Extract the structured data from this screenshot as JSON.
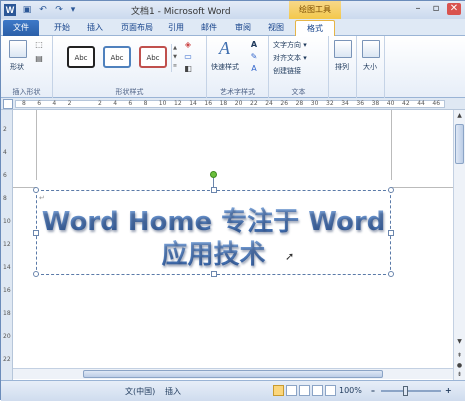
{
  "titlebar": {
    "app_icon": "W",
    "title": "文档1 - Microsoft Word",
    "tool_context": "绘图工具",
    "qat_icons": [
      "save-icon",
      "undo-icon",
      "redo-icon",
      "dropdown-icon"
    ],
    "qat_glyphs": [
      "▣",
      "↶",
      "↷",
      "▾"
    ],
    "win_glyphs": [
      "–",
      "▫",
      "✕"
    ]
  },
  "tabs": [
    "文件",
    "开始",
    "插入",
    "页面布局",
    "引用",
    "邮件",
    "审阅",
    "视图",
    "格式"
  ],
  "ribbon": {
    "groups": {
      "insert_shapes": {
        "label": "插入形状",
        "shapes_label": "形状"
      },
      "shape_styles": {
        "label": "形状样式",
        "swatches": [
          "Abc",
          "Abc",
          "Abc"
        ]
      },
      "wordart_styles": {
        "label": "艺术字样式",
        "quick_styles_label": "快速样式"
      },
      "text": {
        "label": "文本",
        "items": [
          "文字方向 ▾",
          "对齐文本 ▾",
          "创建链接"
        ]
      },
      "arrange": {
        "label": "排列"
      },
      "size": {
        "label": "大小"
      }
    }
  },
  "ruler": {
    "numbers": [
      "8",
      "6",
      "4",
      "2",
      "",
      "2",
      "4",
      "6",
      "8",
      "10",
      "12",
      "14",
      "16",
      "18",
      "20",
      "22",
      "24",
      "26",
      "28",
      "30",
      "32",
      "34",
      "36",
      "38",
      "40",
      "42",
      "44",
      "46"
    ],
    "vnumbers": [
      "2",
      "4",
      "6",
      "8",
      "10",
      "12",
      "14",
      "16",
      "18",
      "20",
      "22"
    ]
  },
  "document": {
    "wordart_line1": "Word Home 专注于 Word",
    "wordart_line2": "应用技术",
    "para_mark": "↵"
  },
  "statusbar": {
    "language": "文(中国)",
    "mode": "插入",
    "zoom": "100%",
    "zoom_out": "–",
    "zoom_in": "+"
  }
}
